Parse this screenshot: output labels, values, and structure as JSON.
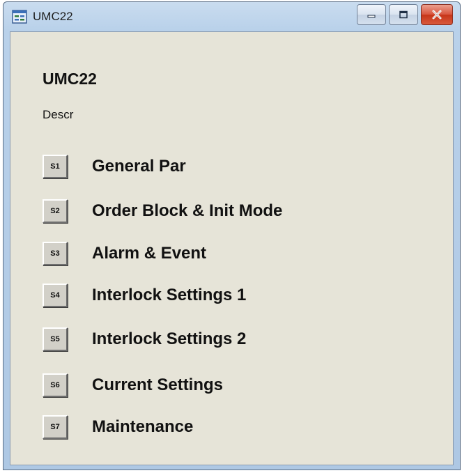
{
  "window": {
    "title": "UMC22",
    "icon": "app-window-icon",
    "controls": {
      "minimize_icon": "minimize-icon",
      "maximize_icon": "maximize-icon",
      "close_icon": "close-icon"
    }
  },
  "content": {
    "title": "UMC22",
    "description": "Descr"
  },
  "menu": {
    "items": [
      {
        "button": "S1",
        "label": "General Par"
      },
      {
        "button": "S2",
        "label": "Order Block & Init Mode"
      },
      {
        "button": "S3",
        "label": "Alarm & Event"
      },
      {
        "button": "S4",
        "label": "Interlock Settings 1"
      },
      {
        "button": "S5",
        "label": "Interlock Settings 2"
      },
      {
        "button": "S6",
        "label": "Current Settings"
      },
      {
        "button": "S7",
        "label": "Maintenance"
      }
    ]
  },
  "colors": {
    "title_bar": "#b9d1ea",
    "client_background": "#e6e4d8",
    "button_face": "#d2d0c8",
    "close_button": "#c63418"
  }
}
